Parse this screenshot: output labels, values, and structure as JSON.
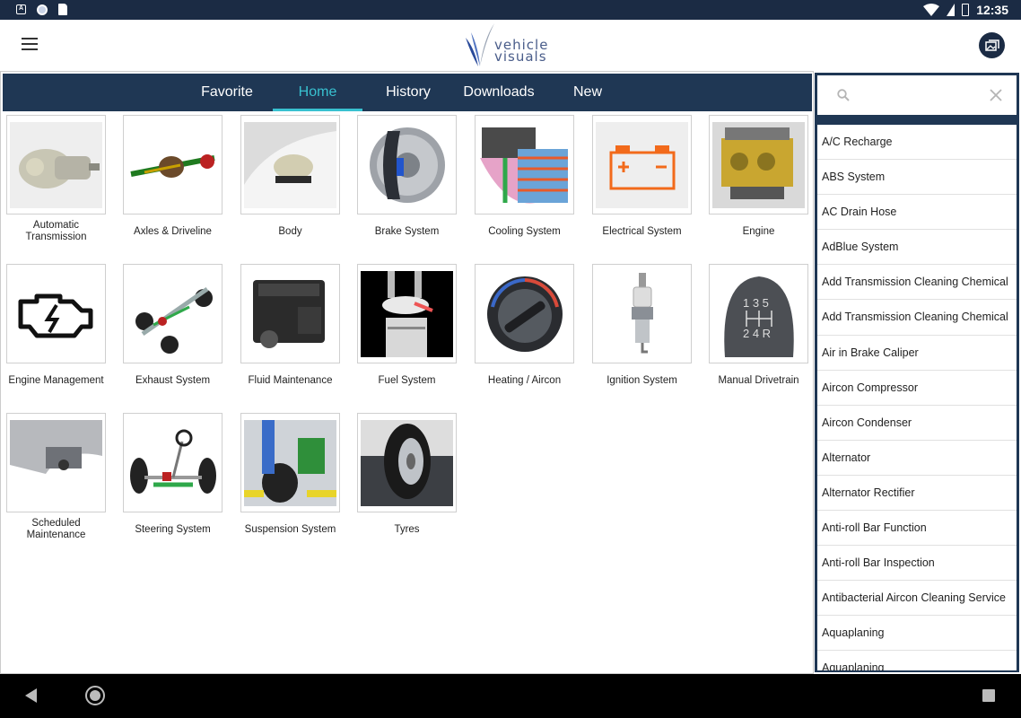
{
  "status_bar": {
    "time": "12:35",
    "left_icons": [
      "a-notification-icon",
      "circle-notification-icon",
      "sd-card-icon"
    ],
    "right_icons": [
      "wifi-icon",
      "battery-icon"
    ]
  },
  "app_bar": {
    "logo_text_1": "vehicle",
    "logo_text_2": "visuals",
    "action_icon": "gallery-icon"
  },
  "tabs": [
    {
      "label": "Favorite",
      "active": false
    },
    {
      "label": "Home",
      "active": true
    },
    {
      "label": "History",
      "active": false
    },
    {
      "label": "Downloads",
      "active": false
    },
    {
      "label": "New",
      "active": false
    }
  ],
  "categories": [
    {
      "label": "Automatic Transmission",
      "icon": "transmission-image"
    },
    {
      "label": "Axles & Driveline",
      "icon": "axle-image"
    },
    {
      "label": "Body",
      "icon": "car-body-image"
    },
    {
      "label": "Brake System",
      "icon": "brake-disc-image"
    },
    {
      "label": "Cooling System",
      "icon": "radiator-image"
    },
    {
      "label": "Electrical System",
      "icon": "battery-image"
    },
    {
      "label": "Engine",
      "icon": "engine-image"
    },
    {
      "label": "Engine Management",
      "icon": "check-engine-image"
    },
    {
      "label": "Exhaust System",
      "icon": "exhaust-image"
    },
    {
      "label": "Fluid Maintenance",
      "icon": "engine-block-image"
    },
    {
      "label": "Fuel System",
      "icon": "injector-image"
    },
    {
      "label": "Heating / Aircon",
      "icon": "climate-knob-image"
    },
    {
      "label": "Ignition System",
      "icon": "spark-plug-image"
    },
    {
      "label": "Manual Drivetrain",
      "icon": "gear-knob-image"
    },
    {
      "label": "Scheduled Maintenance",
      "icon": "service-image"
    },
    {
      "label": "Steering System",
      "icon": "steering-image"
    },
    {
      "label": "Suspension System",
      "icon": "suspension-image"
    },
    {
      "label": "Tyres",
      "icon": "tyre-image"
    }
  ],
  "search": {
    "placeholder": "",
    "value": ""
  },
  "side_list": [
    "A/C Recharge",
    "ABS System",
    "AC Drain Hose",
    "AdBlue System",
    "Add Transmission Cleaning Chemical",
    "Add Transmission Cleaning Chemical",
    "Air in Brake Caliper",
    "Aircon Compressor",
    "Aircon Condenser",
    "Alternator",
    "Alternator Rectifier",
    "Anti-roll Bar Function",
    "Anti-roll Bar Inspection",
    "Antibacterial Aircon Cleaning Service",
    "Aquaplaning",
    "Aquaplaning"
  ],
  "colors": {
    "header": "#1f3754",
    "accent": "#38c1d0",
    "status_bar": "#1b2b44",
    "battery_orange": "#f26a1b"
  }
}
